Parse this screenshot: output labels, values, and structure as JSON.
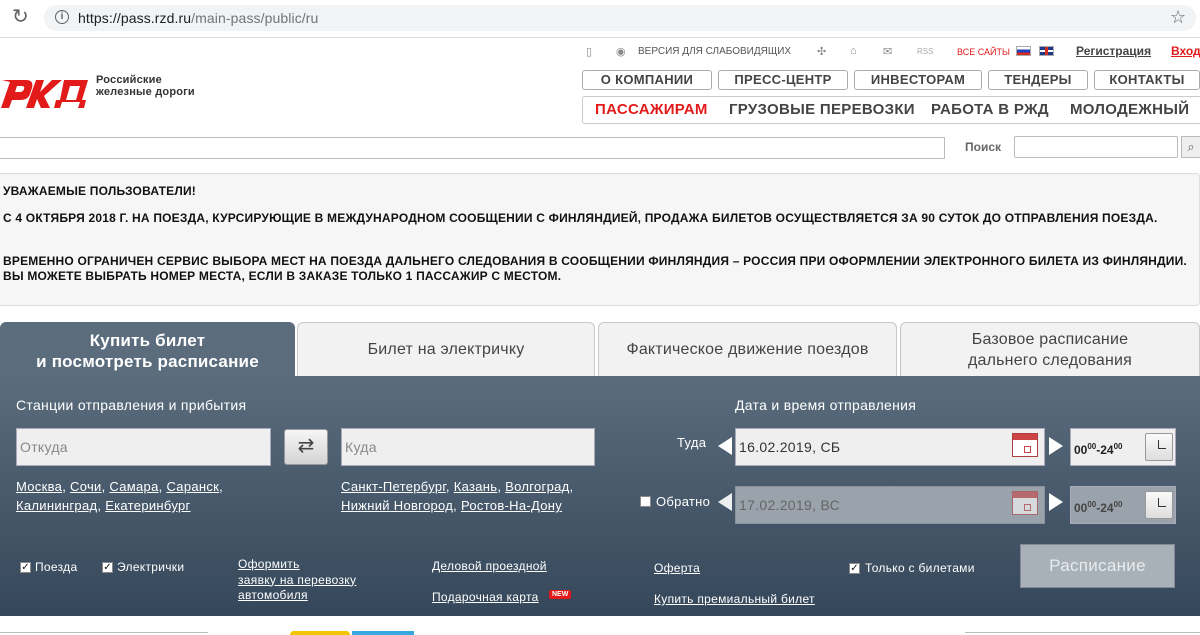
{
  "browser": {
    "url_host": "https://pass.rzd.ru",
    "url_path": "/main-pass/public/ru"
  },
  "header": {
    "logo_line1": "Российские",
    "logo_line2": "железные дороги",
    "top": {
      "vision": "ВЕРСИЯ ДЛЯ СЛАБОВИДЯЩИХ",
      "rss": "RSS",
      "all_sites": "ВСЕ САЙТЫ",
      "register": "Регистрация",
      "login": "Вход"
    },
    "nav1": [
      "О КОМПАНИИ",
      "ПРЕСС-ЦЕНТР",
      "ИНВЕСТОРАМ",
      "ТЕНДЕРЫ",
      "КОНТАКТЫ"
    ],
    "nav2": [
      "ПАССАЖИРАМ",
      "ГРУЗОВЫЕ ПЕРЕВОЗКИ",
      "РАБОТА В РЖД",
      "МОЛОДЕЖНЫЙ"
    ],
    "search_label": "Поиск"
  },
  "notice": {
    "heading": "УВАЖАЕМЫЕ ПОЛЬЗОВАТЕЛИ!",
    "p1": "С 4 ОКТЯБРЯ 2018 Г. НА ПОЕЗДА, КУРСИРУЮЩИЕ В МЕЖДУНАРОДНОМ СООБЩЕНИИ С ФИНЛЯНДИЕЙ, ПРОДАЖА БИЛЕТОВ ОСУЩЕСТВЛЯЕТСЯ ЗА 90 СУТОК ДО ОТПРАВЛЕНИЯ ПОЕЗДА.",
    "p2": "ВРЕМЕННО ОГРАНИЧЕН СЕРВИС ВЫБОРА МЕСТ НА ПОЕЗДА ДАЛЬНЕГО СЛЕДОВАНИЯ В СООБЩЕНИИ ФИНЛЯНДИЯ – РОССИЯ ПРИ ОФОРМЛЕНИИ ЭЛЕКТРОННОГО БИЛЕТА ИЗ ФИНЛЯНДИИ. ВЫ МОЖЕТЕ ВЫБРАТЬ НОМЕР МЕСТА, ЕСЛИ В ЗАКАЗЕ ТОЛЬКО 1 ПАССАЖИР С МЕСТОМ."
  },
  "tabs": [
    {
      "line1": "Купить билет",
      "line2": "и посмотреть расписание"
    },
    {
      "line1": "Билет на электричку",
      "line2": ""
    },
    {
      "line1": "Фактическое движение поездов",
      "line2": ""
    },
    {
      "line1": "Базовое расписание",
      "line2": "дальнего следования"
    }
  ],
  "form": {
    "stations_title": "Станции отправления и прибытия",
    "from_placeholder": "Откуда",
    "to_placeholder": "Куда",
    "from_cities_line1": [
      "Москва",
      "Сочи",
      "Самара",
      "Саранск"
    ],
    "from_cities_line2": [
      "Калининград",
      "Екатеринбург"
    ],
    "to_cities_line1": [
      "Санкт-Петербург",
      "Казань",
      "Волгоград"
    ],
    "to_cities_line2": [
      "Нижний Новгород",
      "Ростов-На-Дону"
    ],
    "date_title": "Дата и время отправления",
    "there_label": "Туда",
    "there_date": "16.02.2019, СБ",
    "back_label": "Обратно",
    "back_date": "17.02.2019, ВС",
    "time_from": "00",
    "time_sep": "-24",
    "time_sup": "00",
    "trains_label": "Поезда",
    "suburban_label": "Электрички",
    "car_link_l1": "Оформить",
    "car_link_l2": "заявку на перевозку",
    "car_link_l3": "автомобиля",
    "business_link": "Деловой проездной",
    "gift_link": "Подарочная карта",
    "new_badge": "NEW",
    "offer_link": "Оферта",
    "premium_link": "Купить премиальный билет",
    "only_tickets_label": "Только с билетами",
    "schedule_button": "Расписание"
  }
}
